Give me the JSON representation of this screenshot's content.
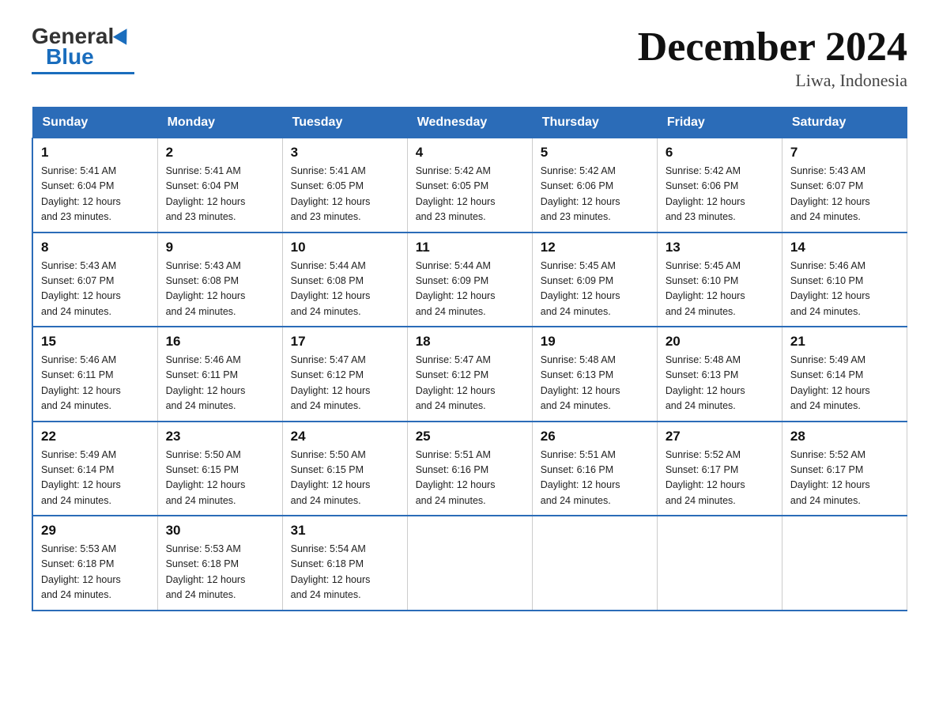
{
  "logo": {
    "general": "General",
    "blue": "Blue"
  },
  "title": "December 2024",
  "subtitle": "Liwa, Indonesia",
  "days_of_week": [
    "Sunday",
    "Monday",
    "Tuesday",
    "Wednesday",
    "Thursday",
    "Friday",
    "Saturday"
  ],
  "weeks": [
    [
      {
        "day": "1",
        "sunrise": "5:41 AM",
        "sunset": "6:04 PM",
        "daylight": "12 hours and 23 minutes."
      },
      {
        "day": "2",
        "sunrise": "5:41 AM",
        "sunset": "6:04 PM",
        "daylight": "12 hours and 23 minutes."
      },
      {
        "day": "3",
        "sunrise": "5:41 AM",
        "sunset": "6:05 PM",
        "daylight": "12 hours and 23 minutes."
      },
      {
        "day": "4",
        "sunrise": "5:42 AM",
        "sunset": "6:05 PM",
        "daylight": "12 hours and 23 minutes."
      },
      {
        "day": "5",
        "sunrise": "5:42 AM",
        "sunset": "6:06 PM",
        "daylight": "12 hours and 23 minutes."
      },
      {
        "day": "6",
        "sunrise": "5:42 AM",
        "sunset": "6:06 PM",
        "daylight": "12 hours and 23 minutes."
      },
      {
        "day": "7",
        "sunrise": "5:43 AM",
        "sunset": "6:07 PM",
        "daylight": "12 hours and 24 minutes."
      }
    ],
    [
      {
        "day": "8",
        "sunrise": "5:43 AM",
        "sunset": "6:07 PM",
        "daylight": "12 hours and 24 minutes."
      },
      {
        "day": "9",
        "sunrise": "5:43 AM",
        "sunset": "6:08 PM",
        "daylight": "12 hours and 24 minutes."
      },
      {
        "day": "10",
        "sunrise": "5:44 AM",
        "sunset": "6:08 PM",
        "daylight": "12 hours and 24 minutes."
      },
      {
        "day": "11",
        "sunrise": "5:44 AM",
        "sunset": "6:09 PM",
        "daylight": "12 hours and 24 minutes."
      },
      {
        "day": "12",
        "sunrise": "5:45 AM",
        "sunset": "6:09 PM",
        "daylight": "12 hours and 24 minutes."
      },
      {
        "day": "13",
        "sunrise": "5:45 AM",
        "sunset": "6:10 PM",
        "daylight": "12 hours and 24 minutes."
      },
      {
        "day": "14",
        "sunrise": "5:46 AM",
        "sunset": "6:10 PM",
        "daylight": "12 hours and 24 minutes."
      }
    ],
    [
      {
        "day": "15",
        "sunrise": "5:46 AM",
        "sunset": "6:11 PM",
        "daylight": "12 hours and 24 minutes."
      },
      {
        "day": "16",
        "sunrise": "5:46 AM",
        "sunset": "6:11 PM",
        "daylight": "12 hours and 24 minutes."
      },
      {
        "day": "17",
        "sunrise": "5:47 AM",
        "sunset": "6:12 PM",
        "daylight": "12 hours and 24 minutes."
      },
      {
        "day": "18",
        "sunrise": "5:47 AM",
        "sunset": "6:12 PM",
        "daylight": "12 hours and 24 minutes."
      },
      {
        "day": "19",
        "sunrise": "5:48 AM",
        "sunset": "6:13 PM",
        "daylight": "12 hours and 24 minutes."
      },
      {
        "day": "20",
        "sunrise": "5:48 AM",
        "sunset": "6:13 PM",
        "daylight": "12 hours and 24 minutes."
      },
      {
        "day": "21",
        "sunrise": "5:49 AM",
        "sunset": "6:14 PM",
        "daylight": "12 hours and 24 minutes."
      }
    ],
    [
      {
        "day": "22",
        "sunrise": "5:49 AM",
        "sunset": "6:14 PM",
        "daylight": "12 hours and 24 minutes."
      },
      {
        "day": "23",
        "sunrise": "5:50 AM",
        "sunset": "6:15 PM",
        "daylight": "12 hours and 24 minutes."
      },
      {
        "day": "24",
        "sunrise": "5:50 AM",
        "sunset": "6:15 PM",
        "daylight": "12 hours and 24 minutes."
      },
      {
        "day": "25",
        "sunrise": "5:51 AM",
        "sunset": "6:16 PM",
        "daylight": "12 hours and 24 minutes."
      },
      {
        "day": "26",
        "sunrise": "5:51 AM",
        "sunset": "6:16 PM",
        "daylight": "12 hours and 24 minutes."
      },
      {
        "day": "27",
        "sunrise": "5:52 AM",
        "sunset": "6:17 PM",
        "daylight": "12 hours and 24 minutes."
      },
      {
        "day": "28",
        "sunrise": "5:52 AM",
        "sunset": "6:17 PM",
        "daylight": "12 hours and 24 minutes."
      }
    ],
    [
      {
        "day": "29",
        "sunrise": "5:53 AM",
        "sunset": "6:18 PM",
        "daylight": "12 hours and 24 minutes."
      },
      {
        "day": "30",
        "sunrise": "5:53 AM",
        "sunset": "6:18 PM",
        "daylight": "12 hours and 24 minutes."
      },
      {
        "day": "31",
        "sunrise": "5:54 AM",
        "sunset": "6:18 PM",
        "daylight": "12 hours and 24 minutes."
      },
      null,
      null,
      null,
      null
    ]
  ],
  "labels": {
    "sunrise": "Sunrise:",
    "sunset": "Sunset:",
    "daylight": "Daylight:"
  }
}
